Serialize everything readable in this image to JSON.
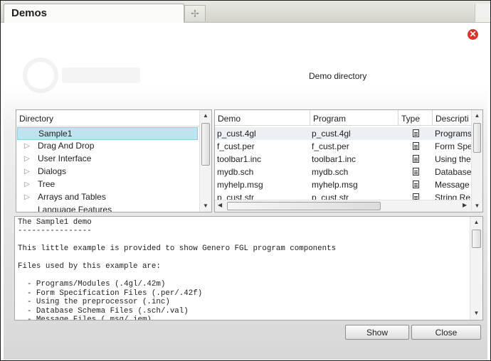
{
  "window": {
    "tab_title": "Demos",
    "new_tab_icon": "plus-icon",
    "close_icon": "close-icon",
    "heading": "Demo directory"
  },
  "tree": {
    "header": "Directory",
    "items": [
      {
        "label": "Sample1",
        "expandable": false,
        "selected": true
      },
      {
        "label": "Drag And Drop",
        "expandable": true
      },
      {
        "label": "User Interface",
        "expandable": true
      },
      {
        "label": "Dialogs",
        "expandable": true
      },
      {
        "label": "Tree",
        "expandable": true
      },
      {
        "label": "Arrays and Tables",
        "expandable": true
      },
      {
        "label": "Language Features",
        "expandable": false
      }
    ]
  },
  "table": {
    "columns": [
      "Demo",
      "Program",
      "Type",
      "Descripti"
    ],
    "rows": [
      {
        "demo": "p_cust.4gl",
        "program": "p_cust.4gl",
        "type_icon": "document-icon",
        "description": "Programs",
        "selected": true
      },
      {
        "demo": "f_cust.per",
        "program": "f_cust.per",
        "type_icon": "document-icon",
        "description": "Form Spe"
      },
      {
        "demo": "toolbar1.inc",
        "program": "toolbar1.inc",
        "type_icon": "document-icon",
        "description": "Using the"
      },
      {
        "demo": "mydb.sch",
        "program": "mydb.sch",
        "type_icon": "document-icon",
        "description": "Database"
      },
      {
        "demo": "myhelp.msg",
        "program": "myhelp.msg",
        "type_icon": "document-icon",
        "description": "Message"
      },
      {
        "demo": "p_cust.str",
        "program": "p_cust.str",
        "type_icon": "document-icon",
        "description": "String Re"
      }
    ]
  },
  "description_text": "The Sample1 demo\n----------------\n\nThis little example is provided to show Genero FGL program components\n\nFiles used by this example are:\n\n  - Programs/Modules (.4gl/.42m)\n  - Form Specification Files (.per/.42f)\n  - Using the preprocessor (.inc)\n  - Database Schema Files (.sch/.val)\n  - Message Files (.msg/.iem)",
  "buttons": {
    "show": "Show",
    "close": "Close"
  },
  "colors": {
    "selection": "#bfe4f0",
    "close_icon": "#d9352a"
  }
}
